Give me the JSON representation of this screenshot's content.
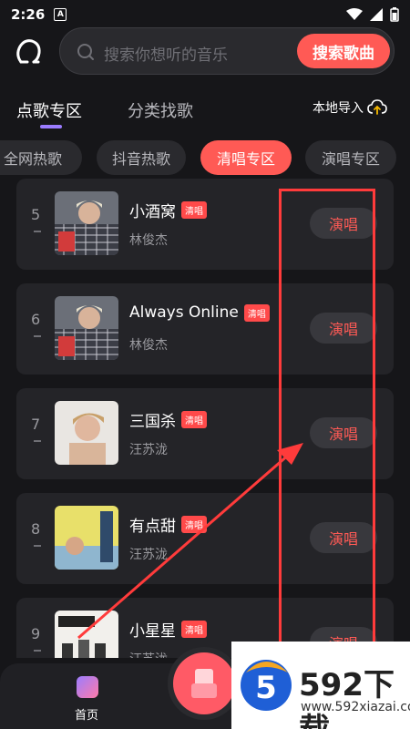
{
  "status_bar": {
    "time": "2:26",
    "app_indicator": "A"
  },
  "search": {
    "placeholder": "搜索你想听的音乐",
    "button_label": "搜索歌曲"
  },
  "tabs": {
    "active": "点歌专区",
    "other": "分类找歌",
    "local_import": "本地导入"
  },
  "categories": [
    "全网热歌",
    "抖音热歌",
    "清唱专区",
    "演唱专区"
  ],
  "active_category": "清唱专区",
  "songs": [
    {
      "rank": "5",
      "title": "小酒窝",
      "tag": "清唱",
      "artist": "林俊杰",
      "action": "演唱"
    },
    {
      "rank": "6",
      "title": "Always Online",
      "tag": "清唱",
      "artist": "林俊杰",
      "action": "演唱"
    },
    {
      "rank": "7",
      "title": "三国杀",
      "tag": "清唱",
      "artist": "汪苏泷",
      "action": "演唱"
    },
    {
      "rank": "8",
      "title": "有点甜",
      "tag": "清唱",
      "artist": "汪苏泷",
      "action": "演唱"
    },
    {
      "rank": "9",
      "title": "小星星",
      "tag": "清唱",
      "artist": "汪苏泷",
      "action": "演唱"
    }
  ],
  "bottom_nav": {
    "home_label": "首页"
  },
  "watermark": {
    "title": "592下载",
    "url": "www.592xiazai.com"
  },
  "colors": {
    "accent": "#ff5a55",
    "background": "#161619",
    "card": "#242428",
    "annotation": "#ff3b3b"
  }
}
